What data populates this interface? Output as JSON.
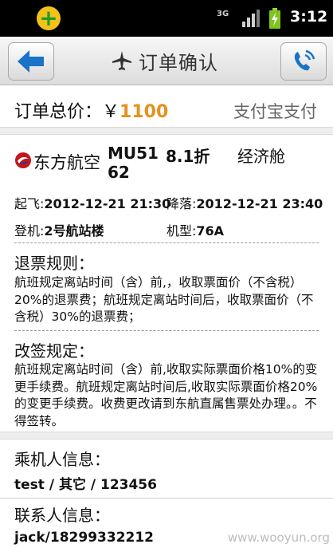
{
  "status_bar": {
    "network": "3G",
    "time": "3:12"
  },
  "header": {
    "title": "订单确认"
  },
  "order": {
    "total_label": "订单总价：",
    "currency": "￥",
    "total_amount": "1100",
    "payment_method": "支付宝支付"
  },
  "flight": {
    "airline": "东方航空",
    "flight_no_line1": "MU51",
    "flight_no_line2": "62",
    "discount": "8.1折",
    "cabin": "经济舱",
    "departure_label": "起飞:",
    "departure_time": "2012-12-21 21:30",
    "arrival_label": "降落:",
    "arrival_time": "2012-12-21 23:40",
    "boarding_label": "登机:",
    "boarding_value": "2号航站楼",
    "aircraft_label": "机型:",
    "aircraft_value": "76A"
  },
  "refund": {
    "title": "退票规则：",
    "text": "航班规定离站时间（含）前,，收取票面价（不含税）20%的退票费；航班规定离站时间后，收取票面价（不含税）30%的退票费；"
  },
  "change": {
    "title": "改签规定：",
    "text": "航班规定离站时间（含）前,收取实际票面价格10%的变更手续费。航班规定离站时间后,收取实际票面价格20%的变更手续费。收费更改请到东航直属售票处办理。。不得签转。"
  },
  "passenger": {
    "title": "乘机人信息：",
    "value": "test / 其它 / 123456"
  },
  "contact": {
    "title": "联系人信息：",
    "value": "jack/18299332212"
  },
  "watermark": "www.wooyun.org"
}
